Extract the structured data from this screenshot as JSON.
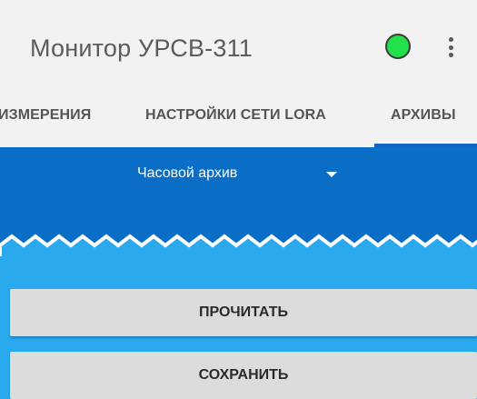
{
  "app": {
    "title": "Монитор УРСВ-311",
    "status_color": "#22e04a",
    "menu_icon": "overflow-menu-icon"
  },
  "tabs": [
    {
      "label": "ИЗМЕРЕНИЯ",
      "selected": false
    },
    {
      "label": "НАСТРОЙКИ СЕТИ LORA",
      "selected": false
    },
    {
      "label": "АРХИВЫ",
      "selected": true
    }
  ],
  "archive": {
    "selected": "Часовой архив"
  },
  "actions": {
    "read_label": "ПРОЧИТАТЬ",
    "save_label": "СОХРАНИТЬ"
  },
  "colors": {
    "accent": "#1565c0",
    "header_blue": "#0a6ec6",
    "panel_blue": "#2aa9ee",
    "button": "#dcdcdc"
  }
}
